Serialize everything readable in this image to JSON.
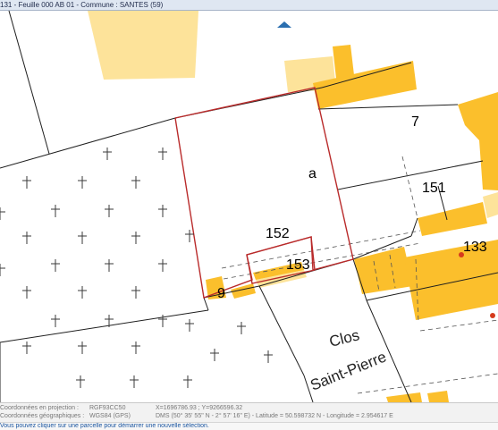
{
  "title_bar": {
    "text": "131 - Feuille 000 AB 01 - Commune : SANTES (59)"
  },
  "map": {
    "parcels": [
      "a",
      "7",
      "151",
      "152",
      "153",
      "133",
      "9"
    ],
    "street": {
      "line1": "Clos",
      "line2": "Saint-Pierre"
    },
    "colors": {
      "building_hard": "#fbbf2c",
      "building_light": "#fde39a",
      "parcel_outline": "#b92b2b",
      "cemetery_cross": "#3a3a3a",
      "nav_arrow": "#2b6fb0",
      "marker": "#d63a1c"
    }
  },
  "info_panel": {
    "projection_label": "Coordonnées en projection :",
    "projection_code": "RGF93CC50",
    "projection_coords": "X=1696786.93 ; Y=9266596.32",
    "geo_label": "Coordonnées géographiques :",
    "geo_code": "WGS84 (GPS)",
    "geo_coords": "DMS (50° 35' 55\" N - 2° 57' 16\" E) - Latitude = 50.598732 N - Longitude = 2.954617 E"
  },
  "status_bar": {
    "text": "Vous pouvez cliquer sur une parcelle pour démarrer une nouvelle sélection."
  }
}
